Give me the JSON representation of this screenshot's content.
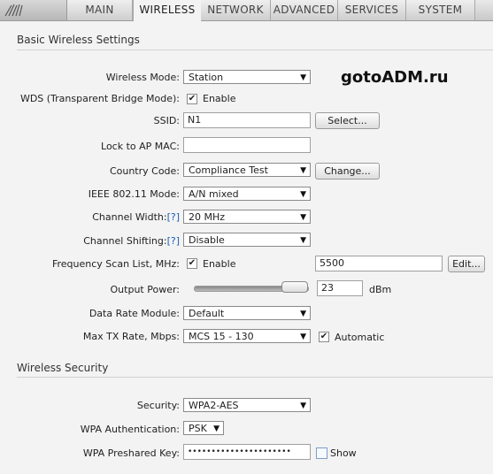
{
  "nav": {
    "tabs": [
      {
        "label": "MAIN"
      },
      {
        "label": "WIRELESS"
      },
      {
        "label": "NETWORK"
      },
      {
        "label": "ADVANCED"
      },
      {
        "label": "SERVICES"
      },
      {
        "label": "SYSTEM"
      }
    ],
    "active_tab": "WIRELESS",
    "logo_icon": "ubiquiti-logo-icon"
  },
  "watermark": "gotoADM.ru",
  "basic": {
    "title": "Basic Wireless Settings",
    "wireless_mode": {
      "label": "Wireless Mode:",
      "value": "Station"
    },
    "wds": {
      "label": "WDS (Transparent Bridge Mode):",
      "checked": true,
      "option": "Enable"
    },
    "ssid": {
      "label": "SSID:",
      "value": "N1",
      "button": "Select..."
    },
    "lock_ap": {
      "label": "Lock to AP MAC:",
      "value": ""
    },
    "country": {
      "label": "Country Code:",
      "value": "Compliance Test",
      "button": "Change..."
    },
    "ieee_mode": {
      "label": "IEEE 802.11 Mode:",
      "value": "A/N mixed"
    },
    "channel_width": {
      "label": "Channel Width:",
      "help": "[?]",
      "value": "20 MHz"
    },
    "channel_shifting": {
      "label": "Channel Shifting:",
      "help": "[?]",
      "value": "Disable"
    },
    "freq_scan": {
      "label": "Frequency Scan List, MHz:",
      "checked": true,
      "option": "Enable",
      "value": "5500",
      "button": "Edit..."
    },
    "output_power": {
      "label": "Output Power:",
      "value": "23",
      "unit": "dBm",
      "level": 0.77
    },
    "data_rate": {
      "label": "Data Rate Module:",
      "value": "Default"
    },
    "max_tx": {
      "label": "Max TX Rate, Mbps:",
      "value": "MCS 15 - 130",
      "checked": true,
      "option": "Automatic"
    }
  },
  "security": {
    "title": "Wireless Security",
    "security": {
      "label": "Security:",
      "value": "WPA2-AES"
    },
    "wpa_auth": {
      "label": "WPA Authentication:",
      "value": "PSK"
    },
    "wpa_key": {
      "label": "WPA Preshared Key:",
      "value": "••••••••••••••••••••••",
      "show_checked": false,
      "show": "Show"
    }
  },
  "colors": {
    "accent_link": "#1a5fb4",
    "topbar": "#c9c9c9"
  }
}
